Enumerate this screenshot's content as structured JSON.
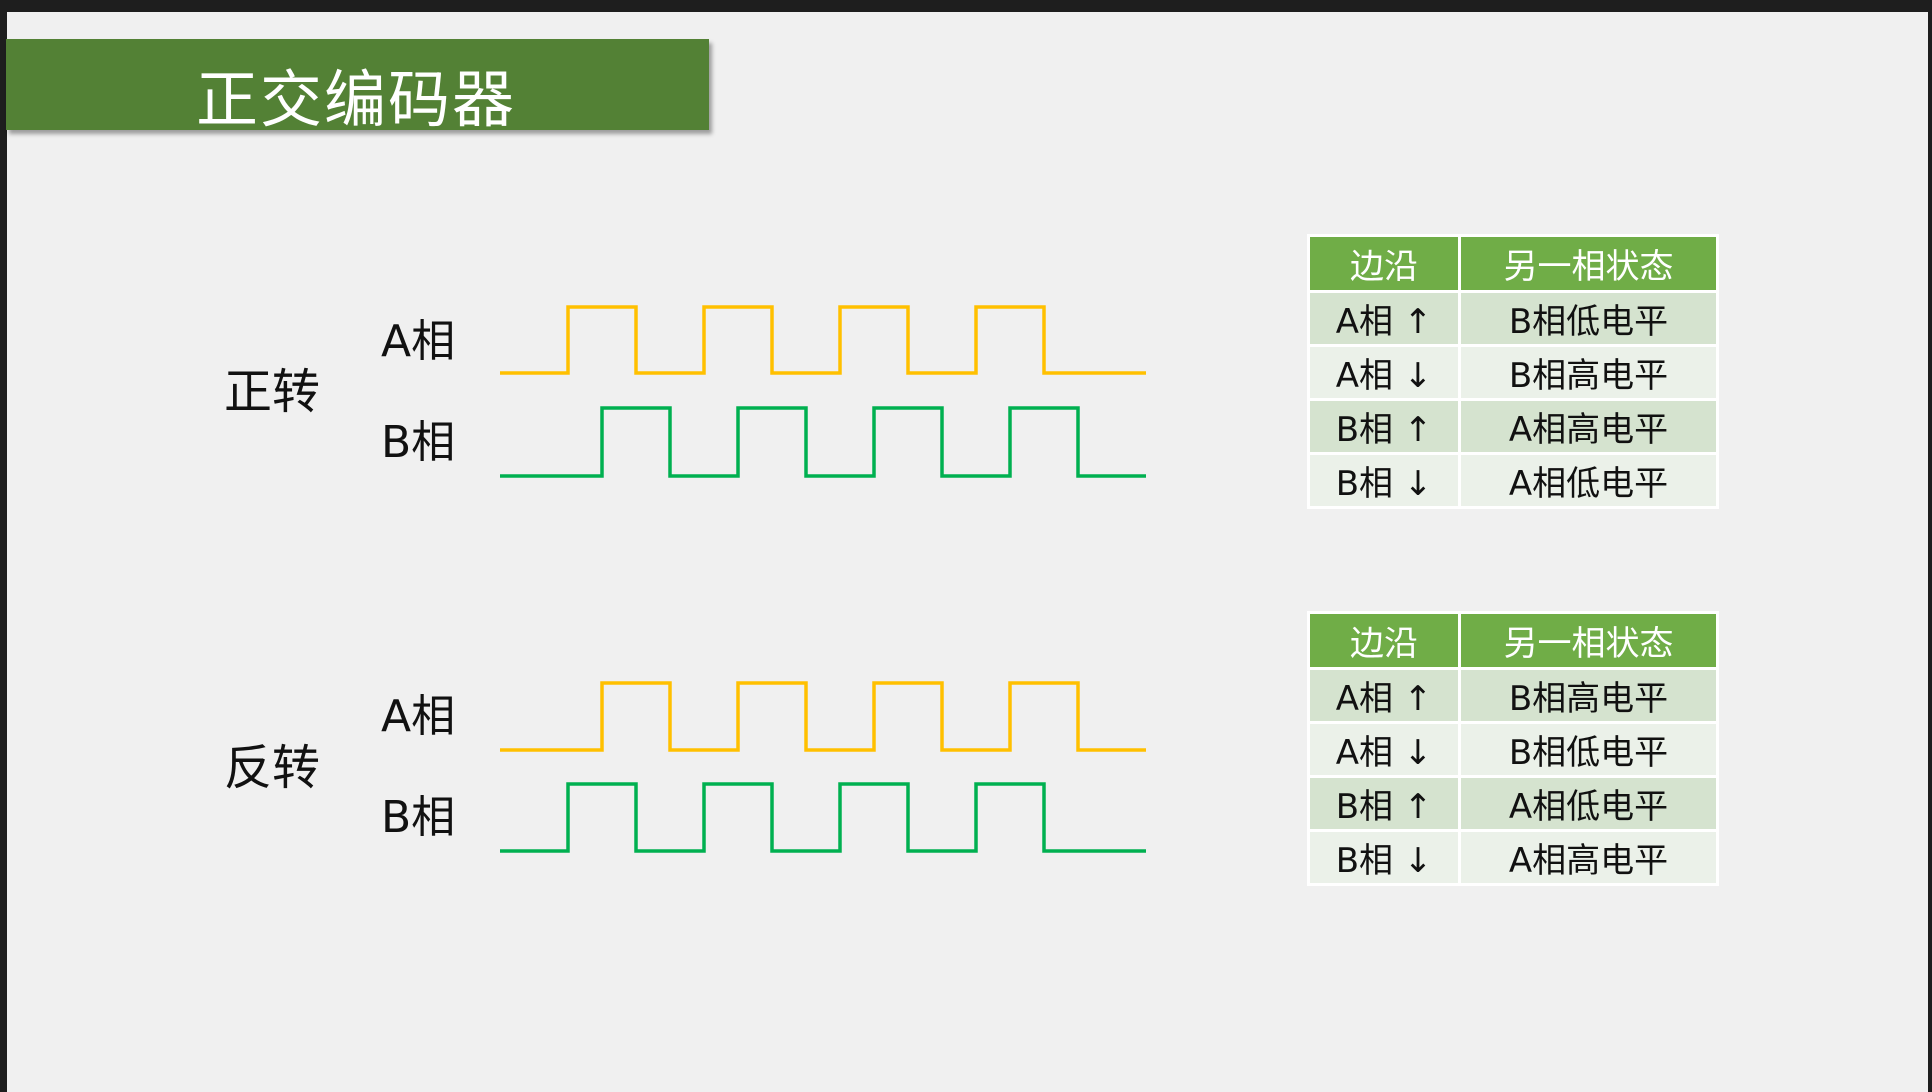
{
  "title": "正交编码器",
  "colors": {
    "title_bg": "#538135",
    "header_bg": "#70AD47",
    "phase_a": "#FFC000",
    "phase_b": "#00B050",
    "row_odd": "#D5E3CF",
    "row_even": "#EBF1E9"
  },
  "forward": {
    "label": "正转",
    "phase_a_label": "A相",
    "phase_b_label": "B相",
    "table": {
      "headers": [
        "边沿",
        "另一相状态"
      ],
      "rows": [
        [
          "A相 ↑",
          "B相低电平"
        ],
        [
          "A相 ↓",
          "B相高电平"
        ],
        [
          "B相 ↑",
          "A相高电平"
        ],
        [
          "B相 ↓",
          "A相低电平"
        ]
      ]
    }
  },
  "reverse": {
    "label": "反转",
    "phase_a_label": "A相",
    "phase_b_label": "B相",
    "table": {
      "headers": [
        "边沿",
        "另一相状态"
      ],
      "rows": [
        [
          "A相 ↑",
          "B相高电平"
        ],
        [
          "A相 ↓",
          "B相低电平"
        ],
        [
          "B相 ↑",
          "A相低电平"
        ],
        [
          "B相 ↓",
          "A相高电平"
        ]
      ]
    }
  },
  "chart_data": {
    "type": "line",
    "title": "Quadrature encoder waveforms (levels per quarter-period step)",
    "series": [
      {
        "name": "正转 A相",
        "levels": [
          0,
          0,
          1,
          1,
          0,
          0,
          1,
          1,
          0,
          0,
          1,
          1,
          0,
          0,
          1,
          1,
          0,
          0,
          0
        ]
      },
      {
        "name": "正转 B相",
        "levels": [
          0,
          0,
          0,
          1,
          1,
          0,
          0,
          1,
          1,
          0,
          0,
          1,
          1,
          0,
          0,
          1,
          1,
          0,
          0
        ]
      },
      {
        "name": "反转 A相",
        "levels": [
          0,
          0,
          0,
          1,
          1,
          0,
          0,
          1,
          1,
          0,
          0,
          1,
          1,
          0,
          0,
          1,
          1,
          0,
          0
        ]
      },
      {
        "name": "反转 B相",
        "levels": [
          0,
          0,
          1,
          1,
          0,
          0,
          1,
          1,
          0,
          0,
          1,
          1,
          0,
          0,
          1,
          1,
          0,
          0,
          0
        ]
      }
    ]
  }
}
